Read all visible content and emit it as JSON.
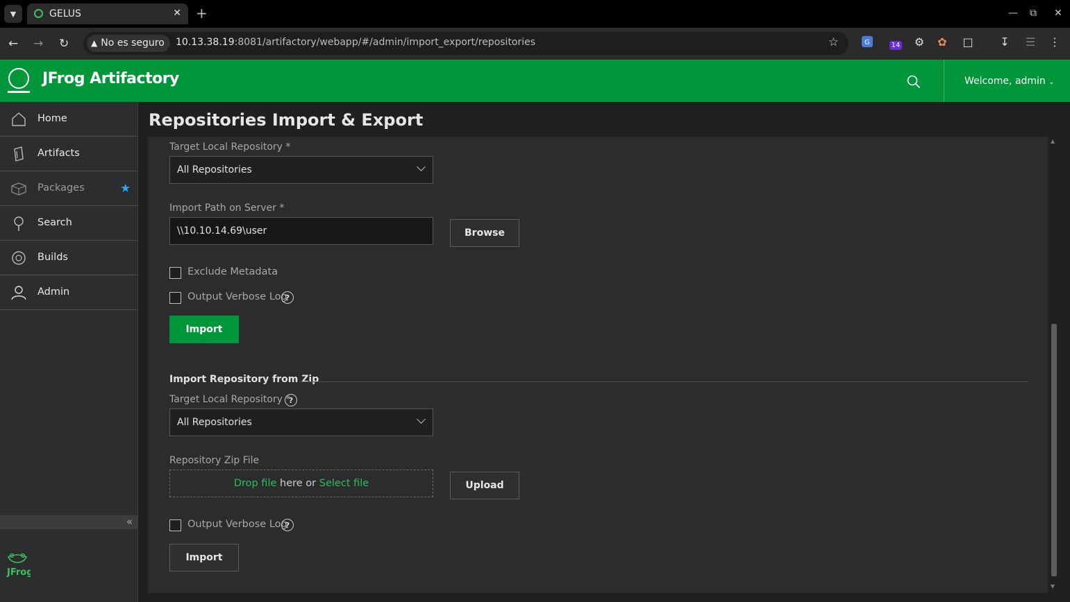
{
  "browser": {
    "tab_title": "GELUS",
    "tab_close": "✕",
    "new_tab": "+",
    "security_label": "No es seguro",
    "url_host": "10.13.38.19",
    "url_rest": ":8081/artifactory/webapp/#/admin/import_export/repositories",
    "extension_badge": "14"
  },
  "app": {
    "name": "JFrog Artifactory",
    "welcome": "Welcome, admin"
  },
  "sidebar": {
    "items": [
      {
        "label": "Home"
      },
      {
        "label": "Artifacts"
      },
      {
        "label": "Packages"
      },
      {
        "label": "Search"
      },
      {
        "label": "Builds"
      },
      {
        "label": "Admin"
      }
    ],
    "collapse": "«",
    "footer_logo_text": "JFrog"
  },
  "page": {
    "title": "Repositories Import & Export",
    "server_import": {
      "target_label": "Target Local Repository *",
      "target_value": "All Repositories",
      "path_label": "Import Path on Server *",
      "path_value": "\\\\10.10.14.69\\user",
      "browse_label": "Browse",
      "exclude_metadata_label": "Exclude Metadata",
      "verbose_label": "Output Verbose Log",
      "import_label": "Import"
    },
    "zip_import": {
      "section_title": "Import Repository from Zip",
      "target_label": "Target Local Repository *",
      "target_value": "All Repositories",
      "zip_label": "Repository Zip File",
      "drop_link": "Drop file",
      "drop_middle": " here or ",
      "select_link": "Select file",
      "upload_label": "Upload",
      "verbose_label": "Output Verbose Log",
      "import_label": "Import"
    },
    "help_glyph": "?"
  },
  "colors": {
    "brand_green": "#00963a",
    "link_green": "#2fbf5a",
    "star_blue": "#2aa7f0"
  }
}
